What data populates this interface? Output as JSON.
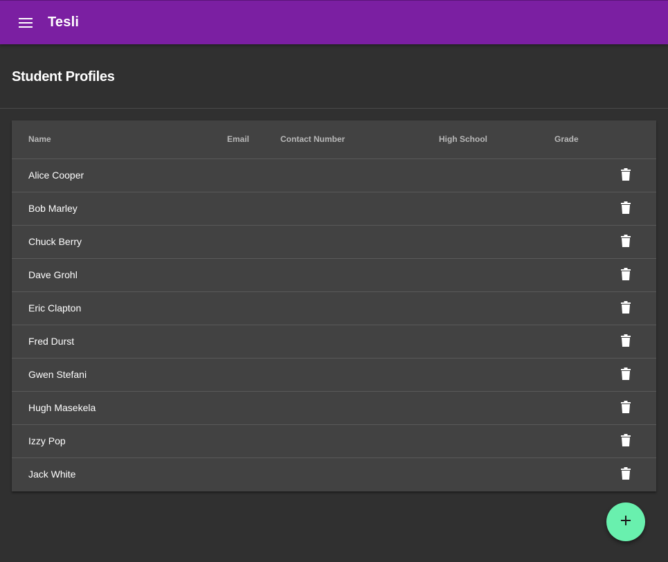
{
  "app_bar": {
    "title": "Tesli",
    "menu_icon": "menu-icon",
    "color": "#7b1fa2"
  },
  "page": {
    "title": "Student Profiles"
  },
  "table": {
    "columns": [
      "Name",
      "Email",
      "Contact Number",
      "High School",
      "Grade"
    ],
    "rows": [
      {
        "name": "Alice Cooper",
        "email": "",
        "contact": "",
        "school": "",
        "grade": ""
      },
      {
        "name": "Bob Marley",
        "email": "",
        "contact": "",
        "school": "",
        "grade": ""
      },
      {
        "name": "Chuck Berry",
        "email": "",
        "contact": "",
        "school": "",
        "grade": ""
      },
      {
        "name": "Dave Grohl",
        "email": "",
        "contact": "",
        "school": "",
        "grade": ""
      },
      {
        "name": "Eric Clapton",
        "email": "",
        "contact": "",
        "school": "",
        "grade": ""
      },
      {
        "name": "Fred Durst",
        "email": "",
        "contact": "",
        "school": "",
        "grade": ""
      },
      {
        "name": "Gwen Stefani",
        "email": "",
        "contact": "",
        "school": "",
        "grade": ""
      },
      {
        "name": "Hugh Masekela",
        "email": "",
        "contact": "",
        "school": "",
        "grade": ""
      },
      {
        "name": "Izzy Pop",
        "email": "",
        "contact": "",
        "school": "",
        "grade": ""
      },
      {
        "name": "Jack White",
        "email": "",
        "contact": "",
        "school": "",
        "grade": ""
      }
    ],
    "row_action_icon": "delete-icon"
  },
  "fab": {
    "icon": "plus-icon",
    "color": "#69f0ae"
  }
}
